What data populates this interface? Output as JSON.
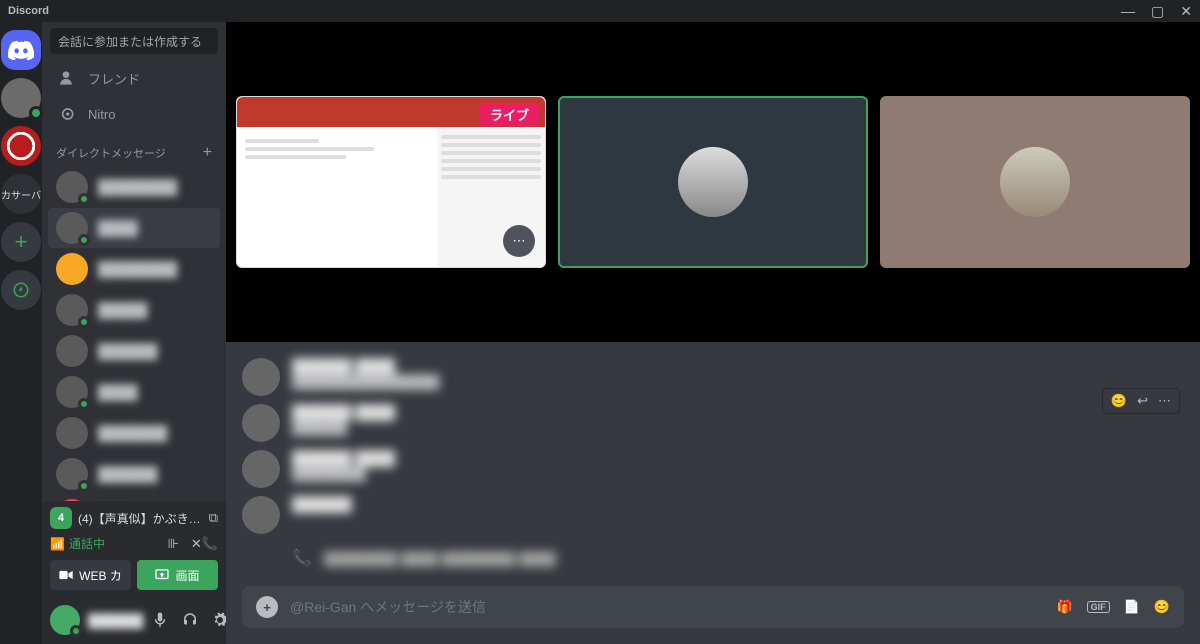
{
  "titlebar": {
    "app_name": "Discord"
  },
  "search": {
    "placeholder": "会話に参加または作成する"
  },
  "nav": {
    "friends": "フレンド",
    "nitro": "Nitro"
  },
  "dm_header": {
    "label": "ダイレクトメッセージ",
    "add": "+"
  },
  "dm_items": [
    {
      "name": "████████",
      "status": "green"
    },
    {
      "name": "████",
      "status": "green",
      "active": true
    },
    {
      "name": "████████",
      "status": "none",
      "color": "#f9a826"
    },
    {
      "name": "█████",
      "status": "green"
    },
    {
      "name": "██████",
      "status": "none"
    },
    {
      "name": "████",
      "status": "green"
    },
    {
      "name": "███████",
      "status": "none"
    },
    {
      "name": "██████",
      "status": "green"
    },
    {
      "name": "███",
      "status": "none",
      "color": "#ed4245"
    }
  ],
  "voice_panel": {
    "count": "4",
    "channel": "(4)【声真似】かぶき…",
    "status": "通話中",
    "btn_video": "WEB カ",
    "btn_screen": "画面"
  },
  "user": {
    "name": "██████"
  },
  "call": {
    "live_tag": "ライブ"
  },
  "messages": [
    {
      "name": "██████ ████",
      "text": "████████████████"
    },
    {
      "name": "██████ ████",
      "text": "██████"
    },
    {
      "name": "██████ ████",
      "text": "████████"
    },
    {
      "name": "██████",
      "text": ""
    }
  ],
  "call_log": {
    "text": "████████ ████ ████████ ████"
  },
  "input": {
    "placeholder": "@Rei-Gan へメッセージを送信",
    "gif": "GIF"
  },
  "servers": {
    "custom_label": "カサーバ"
  }
}
